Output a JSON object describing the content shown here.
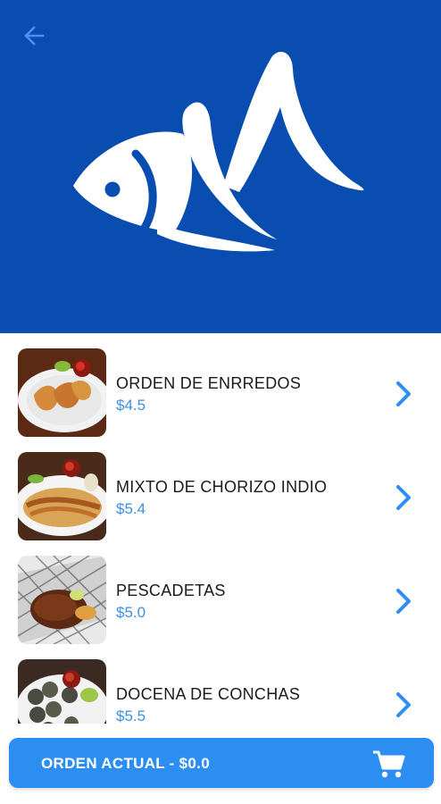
{
  "header": {
    "back_icon": "arrow-left-icon",
    "logo": "fish-m-logo",
    "bg_color": "#0a4db0"
  },
  "menu": {
    "items": [
      {
        "name": "ORDEN DE ENRREDOS",
        "price": "$4.5"
      },
      {
        "name": "MIXTO DE CHORIZO INDIO",
        "price": "$5.4"
      },
      {
        "name": "PESCADETAS",
        "price": "$5.0"
      },
      {
        "name": "DOCENA DE CONCHAS",
        "price": "$5.5"
      }
    ],
    "price_color": "#3d8fe0",
    "chevron_icon": "chevron-right-icon"
  },
  "order_bar": {
    "label": "ORDEN ACTUAL - $0.0",
    "icon": "cart-icon",
    "bg_color": "#2b8ef0"
  }
}
